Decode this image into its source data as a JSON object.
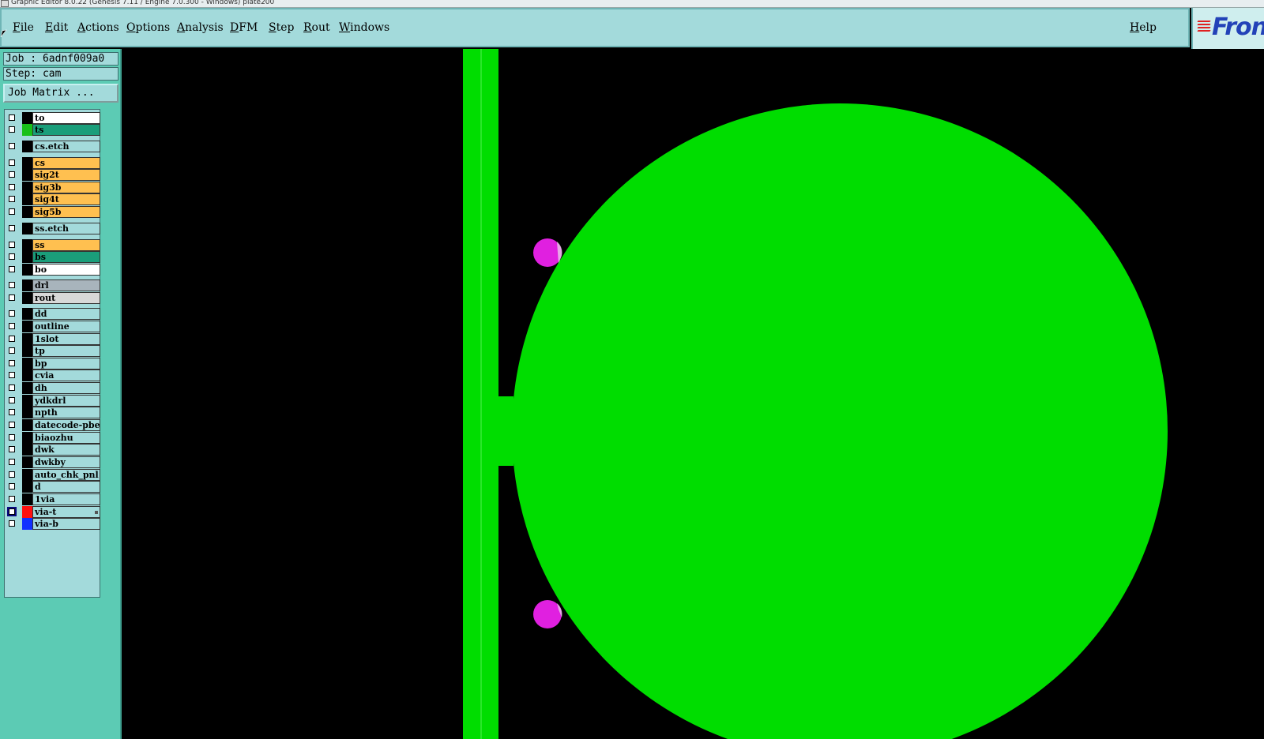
{
  "window": {
    "title": "Graphic Editor 8.0.22 (Genesis 7.11 / Engine 7.0.300 - Windows) plate200"
  },
  "menu": {
    "items": [
      "File",
      "Edit",
      "Actions",
      "Options",
      "Analysis",
      "DFM",
      "Step",
      "Rout",
      "Windows"
    ],
    "help": "Help"
  },
  "logo": {
    "text": "Fron"
  },
  "panel": {
    "job": "Job : 6adnf009a0",
    "step": "Step: cam",
    "job_matrix": "Job Matrix ..."
  },
  "layers": [
    {
      "name": "to",
      "bg": "#ffffff",
      "color": ""
    },
    {
      "name": "ts",
      "bg": "#1a9e7a",
      "color": "#18c018"
    },
    {
      "name": "cs.etch",
      "bg": "#a3dadb",
      "color": ""
    },
    {
      "name": "cs",
      "bg": "#ffc050",
      "color": ""
    },
    {
      "name": "sig2t",
      "bg": "#ffc050",
      "color": ""
    },
    {
      "name": "sig3b",
      "bg": "#ffc050",
      "color": ""
    },
    {
      "name": "sig4t",
      "bg": "#ffc050",
      "color": ""
    },
    {
      "name": "sig5b",
      "bg": "#ffc050",
      "color": ""
    },
    {
      "name": "ss.etch",
      "bg": "#a3dadb",
      "color": ""
    },
    {
      "name": "ss",
      "bg": "#ffc050",
      "color": ""
    },
    {
      "name": "bs",
      "bg": "#1a9e7a",
      "color": ""
    },
    {
      "name": "bo",
      "bg": "#ffffff",
      "color": ""
    },
    {
      "name": "drl",
      "bg": "#a8b4bc",
      "color": ""
    },
    {
      "name": "rout",
      "bg": "#d8d8d8",
      "color": ""
    },
    {
      "name": "dd",
      "bg": "#a3dadb",
      "color": ""
    },
    {
      "name": "outline",
      "bg": "#a3dadb",
      "color": ""
    },
    {
      "name": "1slot",
      "bg": "#a3dadb",
      "color": ""
    },
    {
      "name": "tp",
      "bg": "#a3dadb",
      "color": ""
    },
    {
      "name": "bp",
      "bg": "#a3dadb",
      "color": ""
    },
    {
      "name": "cvia",
      "bg": "#a3dadb",
      "color": ""
    },
    {
      "name": "dh",
      "bg": "#a3dadb",
      "color": ""
    },
    {
      "name": "ydkdrl",
      "bg": "#a3dadb",
      "color": ""
    },
    {
      "name": "npth",
      "bg": "#a3dadb",
      "color": ""
    },
    {
      "name": "datecode-pbe",
      "bg": "#a3dadb",
      "color": ""
    },
    {
      "name": "biaozhu",
      "bg": "#a3dadb",
      "color": ""
    },
    {
      "name": "dwk",
      "bg": "#a3dadb",
      "color": ""
    },
    {
      "name": "dwkby",
      "bg": "#a3dadb",
      "color": ""
    },
    {
      "name": "auto_chk_pnl",
      "bg": "#a3dadb",
      "color": ""
    },
    {
      "name": "d",
      "bg": "#a3dadb",
      "color": ""
    },
    {
      "name": "1via",
      "bg": "#a3dadb",
      "color": ""
    },
    {
      "name": "via-t",
      "bg": "#a3dadb",
      "color": "#ff1010",
      "checked": true,
      "flag": true
    },
    {
      "name": "via-b",
      "bg": "#a3dadb",
      "color": "#1030ff"
    }
  ],
  "colors": {
    "feature_green": "#00dd00",
    "drill_magenta": "#e020e0",
    "panel_bg": "#5ccbb4",
    "menu_bg": "#a3dadb"
  }
}
